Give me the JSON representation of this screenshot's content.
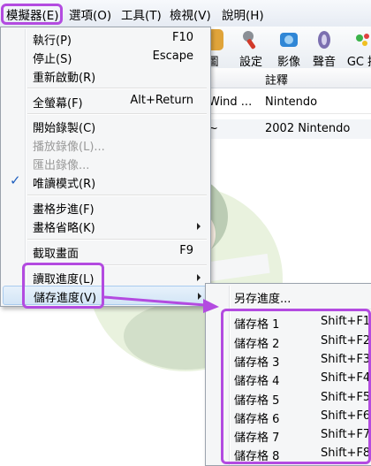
{
  "menubar": {
    "items": [
      "模擬器(E)",
      "選項(O)",
      "工具(T)",
      "檢視(V)",
      "說明(H)"
    ]
  },
  "toolbar": {
    "buttons": [
      {
        "label": "圖",
        "icon": "image-icon"
      },
      {
        "label": "設定",
        "icon": "settings-icon"
      },
      {
        "label": "影像",
        "icon": "video-icon"
      },
      {
        "label": "聲音",
        "icon": "sound-icon"
      },
      {
        "label": "GC 控",
        "icon": "gc-controller-icon"
      }
    ]
  },
  "game_list": {
    "header_label": "註釋",
    "rows": [
      {
        "name": "Wind ...",
        "note": "Nintendo"
      },
      {
        "name": "~",
        "note": "2002 Nintendo"
      }
    ]
  },
  "emulation_menu": {
    "items": [
      {
        "label": "執行(P)",
        "shortcut": "F10"
      },
      {
        "label": "停止(S)",
        "shortcut": "Escape"
      },
      {
        "label": "重新啟動(R)",
        "shortcut": ""
      },
      {
        "label": "全螢幕(F)",
        "shortcut": "Alt+Return"
      },
      {
        "label": "開始錄製(C)",
        "shortcut": ""
      },
      {
        "label": "播放錄像(L)...",
        "shortcut": ""
      },
      {
        "label": "匯出錄像...",
        "shortcut": ""
      },
      {
        "label": "唯讀模式(R)",
        "shortcut": ""
      },
      {
        "label": "畫格步進(F)",
        "shortcut": ""
      },
      {
        "label": "畫格省略(K)",
        "shortcut": ""
      },
      {
        "label": "截取畫面",
        "shortcut": "F9"
      },
      {
        "label": "讀取進度(L)",
        "shortcut": ""
      },
      {
        "label": "儲存進度(V)",
        "shortcut": ""
      }
    ]
  },
  "save_state_menu": {
    "items": [
      {
        "label": "另存進度...",
        "shortcut": ""
      },
      {
        "label": "儲存格 1",
        "shortcut": "Shift+F1"
      },
      {
        "label": "儲存格 2",
        "shortcut": "Shift+F2"
      },
      {
        "label": "儲存格 3",
        "shortcut": "Shift+F3"
      },
      {
        "label": "儲存格 4",
        "shortcut": "Shift+F4"
      },
      {
        "label": "儲存格 5",
        "shortcut": "Shift+F5"
      },
      {
        "label": "儲存格 6",
        "shortcut": "Shift+F6"
      },
      {
        "label": "儲存格 7",
        "shortcut": "Shift+F7"
      },
      {
        "label": "儲存格 8",
        "shortcut": "Shift+F8"
      }
    ]
  },
  "annotation_color": "#b34be0"
}
